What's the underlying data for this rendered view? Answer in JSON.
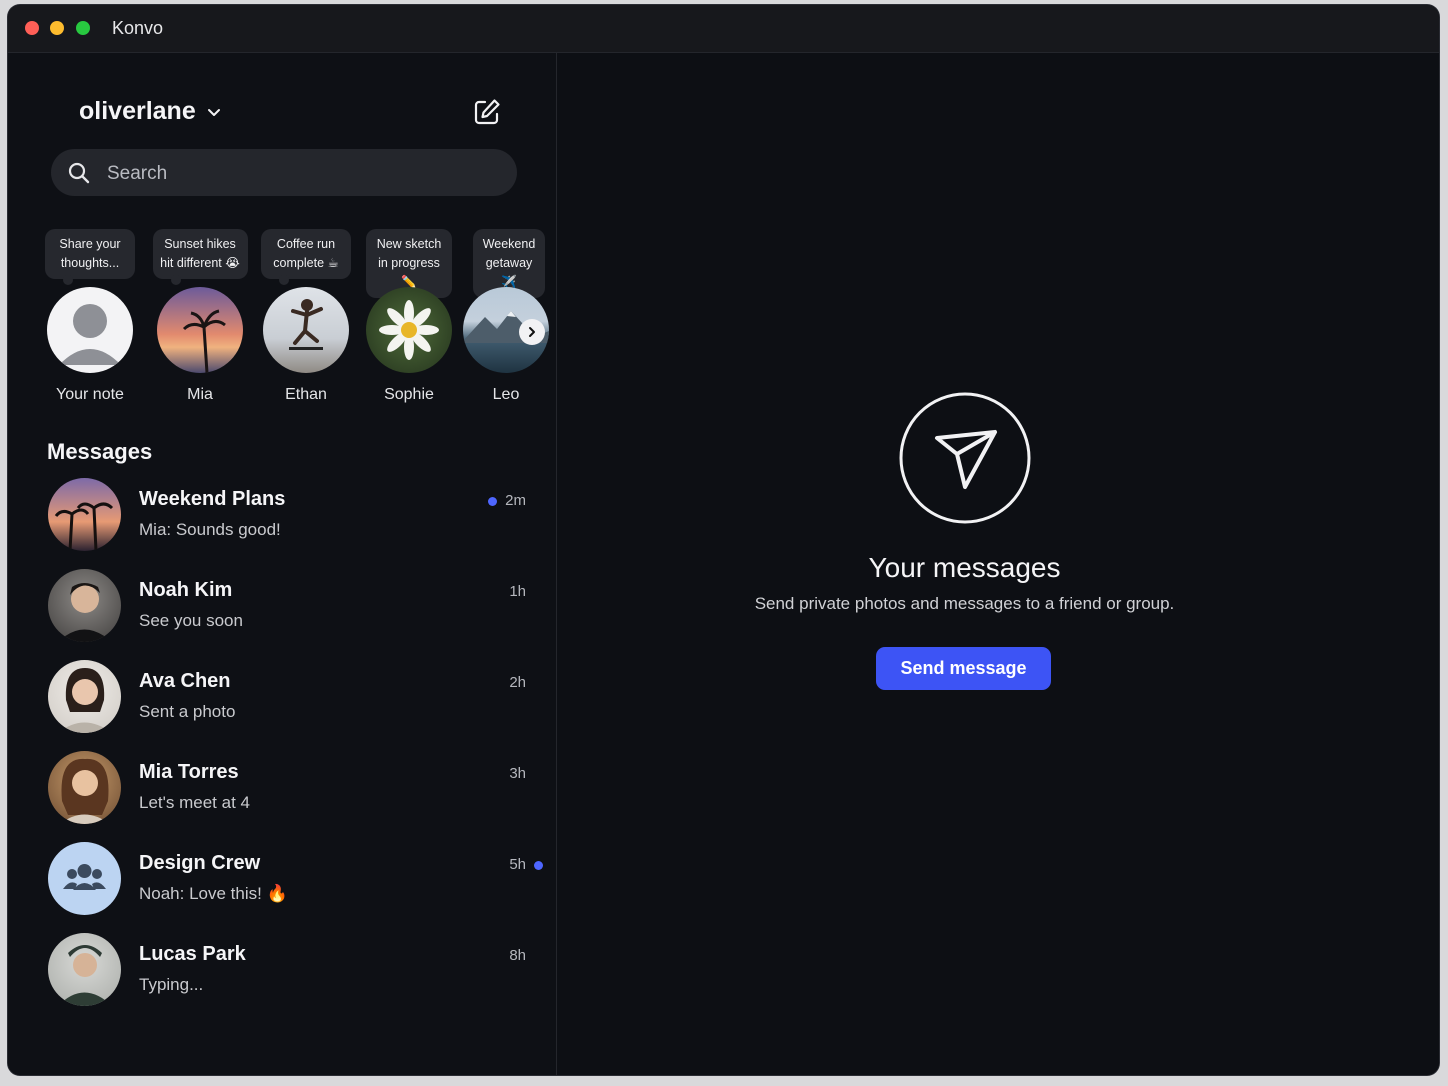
{
  "app": {
    "title": "Konvo"
  },
  "sidebar": {
    "account_name": "oliverlane",
    "search": {
      "placeholder": "Search"
    },
    "notes": [
      {
        "bubble": "Share your thoughts...",
        "label": "Your note"
      },
      {
        "bubble": "Sunset hikes hit different 😭",
        "label": "Mia"
      },
      {
        "bubble": "Coffee run complete ☕",
        "label": "Ethan"
      },
      {
        "bubble": "New sketch in progress ✏️",
        "label": "Sophie"
      },
      {
        "bubble": "Weekend getaway ✈️",
        "label": "Leo"
      }
    ],
    "messages_heading": "Messages",
    "conversations": [
      {
        "name": "Weekend Plans",
        "preview": "Mia: Sounds good!",
        "time": "2m"
      },
      {
        "name": "Noah Kim",
        "preview": "See you soon",
        "time": "1h"
      },
      {
        "name": "Ava Chen",
        "preview": "Sent a photo",
        "time": "2h"
      },
      {
        "name": "Mia Torres",
        "preview": "Let's meet at 4",
        "time": "3h"
      },
      {
        "name": "Design Crew",
        "preview": "Noah: Love this! 🔥",
        "time": "5h"
      },
      {
        "name": "Lucas Park",
        "preview": "Typing...",
        "time": "8h"
      }
    ]
  },
  "main": {
    "title": "Your messages",
    "subtitle": "Send private photos and messages to a friend or group.",
    "button_label": "Send message"
  },
  "colors": {
    "accent": "#3d54f5",
    "unread_dot": "#4e66ff",
    "background": "#0d0f14"
  }
}
